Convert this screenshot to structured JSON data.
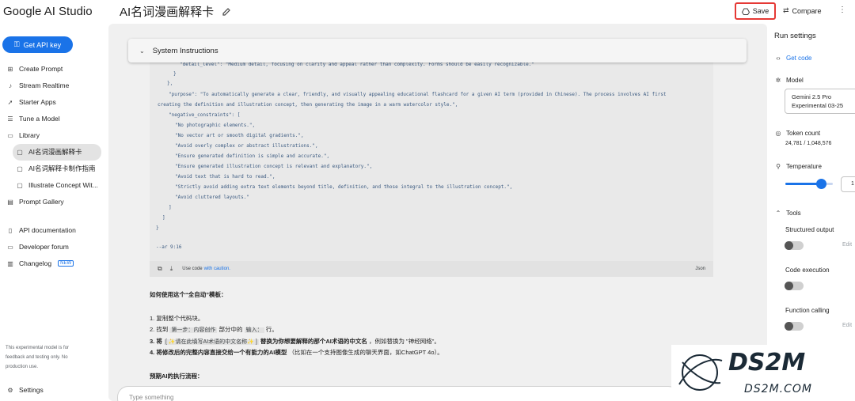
{
  "header": {
    "brand": "Google AI Studio",
    "doc_title": "AI名词漫画解释卡",
    "save_label": "Save",
    "compare_label": "Compare"
  },
  "sidebar": {
    "api_key_label": "Get API key",
    "items": [
      {
        "label": "Create Prompt",
        "icon": "create-prompt-icon"
      },
      {
        "label": "Stream Realtime",
        "icon": "mic-icon"
      },
      {
        "label": "Starter Apps",
        "icon": "rocket-icon"
      },
      {
        "label": "Tune a Model",
        "icon": "tune-icon"
      },
      {
        "label": "Library",
        "icon": "library-icon"
      }
    ],
    "library_items": [
      {
        "label": "AI名词漫画解释卡",
        "active": true
      },
      {
        "label": "AI名词解释卡制作指南",
        "active": false
      },
      {
        "label": "Illustrate Concept Wit...",
        "active": false
      }
    ],
    "gallery_label": "Prompt Gallery",
    "api_docs_label": "API documentation",
    "dev_forum_label": "Developer forum",
    "changelog_label": "Changelog",
    "new_badge": "NEW",
    "note": "This experimental model is for feedback and testing only. No production use.",
    "settings_label": "Settings"
  },
  "main": {
    "system_instructions_label": "System Instructions",
    "code_lines": [
      "\"detail_level\": \"Medium detail, focusing on clarity and appeal rather than complexity. Forms should be easily recognizable.\"",
      "}",
      "},",
      "\"purpose\": \"To automatically generate a clear, friendly, and visually appealing educational flashcard for a given AI term (provided in Chinese). The process involves AI first",
      "creating the definition and illustration concept, then generating the image in a warm watercolor style.\",",
      "\"negative_constraints\": [",
      "\"No photographic elements.\",",
      "\"No vector art or smooth digital gradients.\",",
      "\"Avoid overly complex or abstract illustrations.\",",
      "\"Ensure generated definition is simple and accurate.\",",
      "\"Ensure generated illustration concept is relevant and explanatory.\",",
      "\"Avoid text that is hard to read.\",",
      "\"Strictly avoid adding extra text elements beyond title, definition, and those integral to the illustration concept.\",",
      "\"Avoid cluttered layouts.\"",
      "]",
      "]",
      "}",
      "--ar 9:16"
    ],
    "code_footer": {
      "caution_prefix": "Use code",
      "caution_link": "with caution.",
      "lang": "Json"
    },
    "howto_heading": "如何使用这个“全自动”模板：",
    "steps": {
      "s1": "1. 复制整个代码块。",
      "s2_a": "2. 找到",
      "s2_chip1": "第一步：内容创作",
      "s2_b": "部分中的",
      "s2_chip2": "输入：",
      "s2_c": "行。",
      "s3_a": "3. 将",
      "s3_chip": "[ ✨请在此填写AI术语的中文名称✨ ]",
      "s3_b": "替换为你想要解释的那个AI术语的中文名",
      "s3_c": "，例如替换为 \"神经网络\"。",
      "s4_a": "4. 将修改后的完整内容直接交给一个有能力的AI模型",
      "s4_b": "（比如在一个支持图像生成的聊天界面，如ChatGPT 4o）。"
    },
    "expected_heading": "预期AI的执行流程：",
    "input_placeholder": "Type something"
  },
  "right_panel": {
    "title": "Run settings",
    "get_code": "Get code",
    "model_label": "Model",
    "model_value_line1": "Gemini 2.5 Pro",
    "model_value_line2": "Experimental 03-25",
    "token_label": "Token count",
    "token_value": "24,781 / 1,048,576",
    "temperature_label": "Temperature",
    "temperature_value": "1",
    "temperature_fraction": 0.75,
    "tools_label": "Tools",
    "tools": [
      {
        "label": "Structured output",
        "edit": "Edit"
      },
      {
        "label": "Code execution",
        "edit": ""
      },
      {
        "label": "Function calling",
        "edit": "Edit"
      }
    ]
  },
  "watermark": {
    "logo_text": "DS2M",
    "url_text": "DS2M.COM"
  },
  "colors": {
    "accent": "#1a73e8",
    "save_outline": "#e53935",
    "code_text": "#3b5a80"
  }
}
